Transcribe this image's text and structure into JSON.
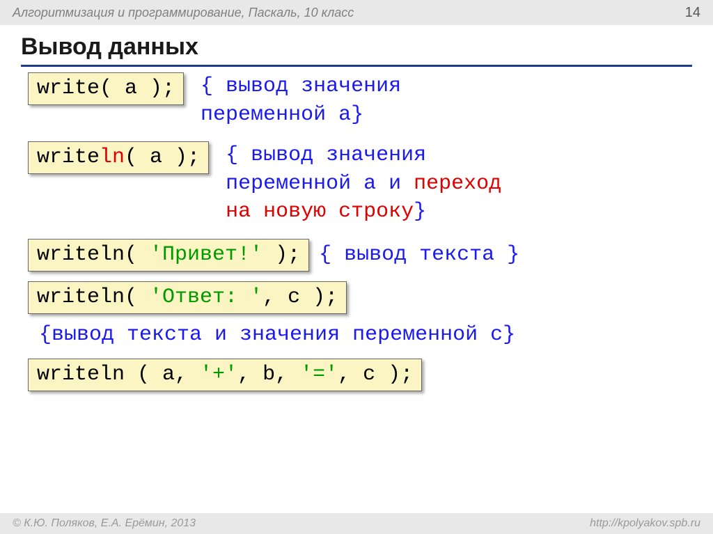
{
  "breadcrumb": "Алгоритмизация и программирование, Паскаль, 10 класс",
  "page_number": "14",
  "title": "Вывод данных",
  "rows": {
    "r1": {
      "code": "write( a );",
      "comment_a": "{ вывод значения",
      "comment_b": "  переменной a}"
    },
    "r2": {
      "code_a": "write",
      "code_ln": "ln",
      "code_b": "( a );",
      "comment_a": "{ вывод значения",
      "comment_b": "  переменной a и ",
      "comment_red1": "переход",
      "comment_red2": "  на новую строку",
      "comment_close": "}"
    },
    "r3": {
      "code_a": "writeln( ",
      "code_str": "'Привет!'",
      "code_b": " );",
      "comment": "{ вывод текста }"
    },
    "r4": {
      "code_a": "writeln( ",
      "code_str": "'Ответ: '",
      "code_b": ", c );"
    },
    "r4_comment": "{вывод текста и значения переменной c}",
    "r5": {
      "code_a": "writeln ( a, ",
      "code_s1": "'+'",
      "code_b": ", b, ",
      "code_s2": "'='",
      "code_c": ", c );"
    }
  },
  "footer_left": "© К.Ю. Поляков, Е.А. Ерёмин, 2013",
  "footer_right": "http://kpolyakov.spb.ru"
}
